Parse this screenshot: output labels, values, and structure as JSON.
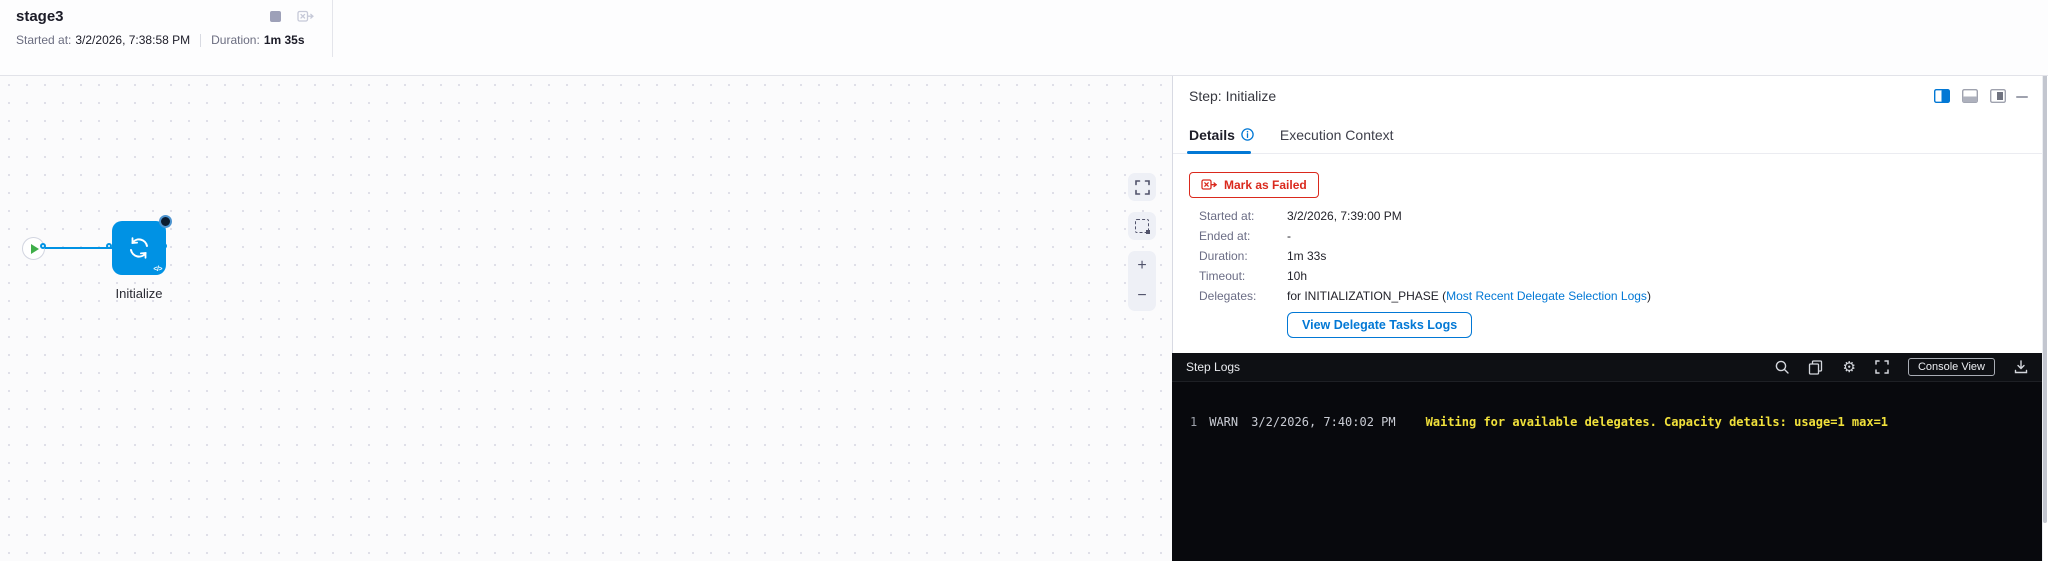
{
  "colors": {
    "accent_blue": "#0278d5",
    "node_blue": "#0092e4",
    "danger_red": "#da291d",
    "success_green": "#3fae49",
    "log_warn_yellow": "#f1e13b",
    "console_bg": "#08090d"
  },
  "stage_header": {
    "title": "stage3",
    "started_label": "Started at:",
    "started_value": "3/2/2026, 7:38:58 PM",
    "duration_label": "Duration:",
    "duration_value": "1m 35s"
  },
  "graph": {
    "node_label": "Initialize",
    "node_code_glyph": "</>"
  },
  "canvas_controls": {
    "zoom_in": "+",
    "zoom_out": "−"
  },
  "step_panel": {
    "title": "Step: Initialize",
    "tabs": [
      {
        "label": "Details"
      },
      {
        "label": "Execution Context"
      }
    ],
    "mark_as_failed": "Mark as Failed",
    "details": [
      {
        "label": "Started at:",
        "value": "3/2/2026, 7:39:00 PM"
      },
      {
        "label": "Ended at:",
        "value": "-"
      },
      {
        "label": "Duration:",
        "value": "1m 33s"
      },
      {
        "label": "Timeout:",
        "value": "10h"
      },
      {
        "label": "Delegates:",
        "prefix": "for INITIALIZATION_PHASE (",
        "link": "Most Recent Delegate Selection Logs",
        "suffix": ")"
      }
    ],
    "view_delegate_logs": "View Delegate Tasks Logs"
  },
  "step_logs": {
    "title": "Step Logs",
    "console_view": "Console View",
    "lines": [
      {
        "num": "1",
        "level": "WARN",
        "timestamp": "3/2/2026, 7:40:02 PM",
        "message": "Waiting for available delegates. Capacity details: usage=1 max=1"
      }
    ]
  }
}
